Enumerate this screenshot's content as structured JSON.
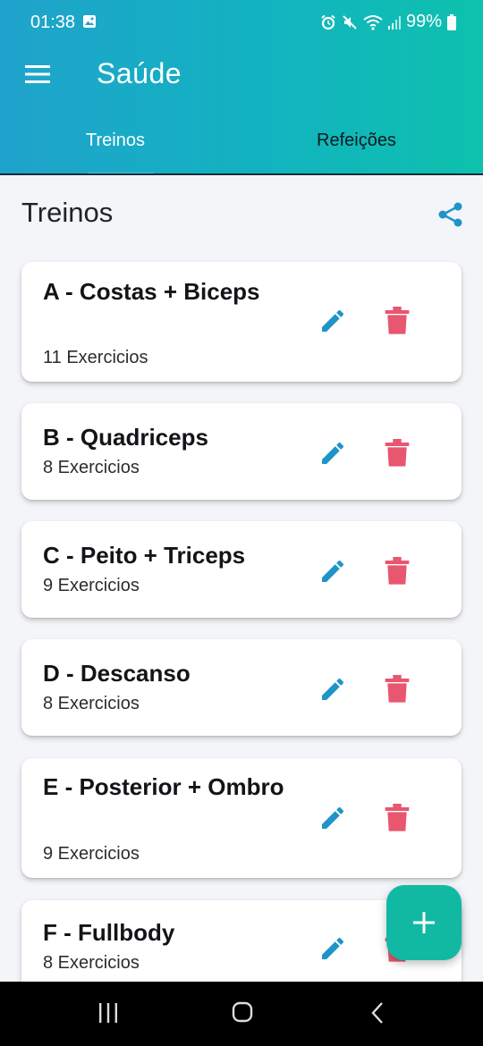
{
  "status_bar": {
    "time": "01:38",
    "battery": "99%"
  },
  "app_bar": {
    "title": "Saúde"
  },
  "tabs": [
    {
      "label": "Treinos",
      "active": true
    },
    {
      "label": "Refeições",
      "active": false
    }
  ],
  "section": {
    "title": "Treinos"
  },
  "workouts": [
    {
      "title": "A - Costas + Biceps",
      "subtitle": "11 Exercicios"
    },
    {
      "title": "B - Quadriceps",
      "subtitle": "8 Exercicios"
    },
    {
      "title": "C - Peito + Triceps",
      "subtitle": "9 Exercicios"
    },
    {
      "title": "D - Descanso",
      "subtitle": "8 Exercicios"
    },
    {
      "title": "E - Posterior + Ombro",
      "subtitle": "9 Exercicios"
    },
    {
      "title": "F - Fullbody",
      "subtitle": "8 Exercicios"
    }
  ],
  "fab": {
    "symbol": "+"
  },
  "colors": {
    "accent_blue": "#1e94c8",
    "delete_red": "#e8566f",
    "fab_teal": "#11b9a3"
  }
}
